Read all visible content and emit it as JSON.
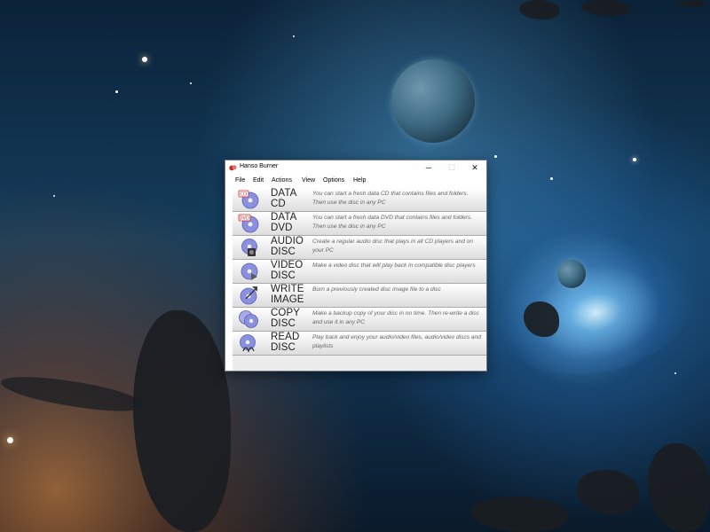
{
  "window": {
    "title": "Hanso Burner",
    "controls": {
      "minimize": "─",
      "maximize": "☐",
      "close": "✕"
    }
  },
  "menu": [
    "File",
    "Edit",
    "Actions",
    "View",
    "Options",
    "Help"
  ],
  "items": [
    {
      "title": "DATA\nCD",
      "description": "You can start a fresh data CD that contains files and folders. Then use the disc in any PC",
      "icon": "data-cd-icon"
    },
    {
      "title": "DATA\nDVD",
      "description": "You can start a fresh data DVD that contains files and folders. Then use the disc in any PC",
      "icon": "data-dvd-icon"
    },
    {
      "title": "AUDIO\nDISC",
      "description": "Create a regular audio disc that plays in all CD players and on your PC",
      "icon": "audio-disc-icon"
    },
    {
      "title": "VIDEO\nDISC",
      "description": "Make a video disc that will play back in compatible disc players",
      "icon": "video-disc-icon"
    },
    {
      "title": "WRITE\nIMAGE",
      "description": "Burn a previously created disc image file to a disc",
      "icon": "write-image-icon"
    },
    {
      "title": "COPY\nDISC",
      "description": "Make a backup copy of your disc in no time. Then re-write a disc and use it in any PC",
      "icon": "copy-disc-icon"
    },
    {
      "title": "READ\nDISC",
      "description": "Play back and enjoy your audio/video files, audio/video discs and playlists",
      "icon": "read-disc-icon"
    }
  ],
  "colors": {
    "accent": "#c62828",
    "disc": "#7a7fd8",
    "text": "#222222",
    "desc": "#666666"
  }
}
